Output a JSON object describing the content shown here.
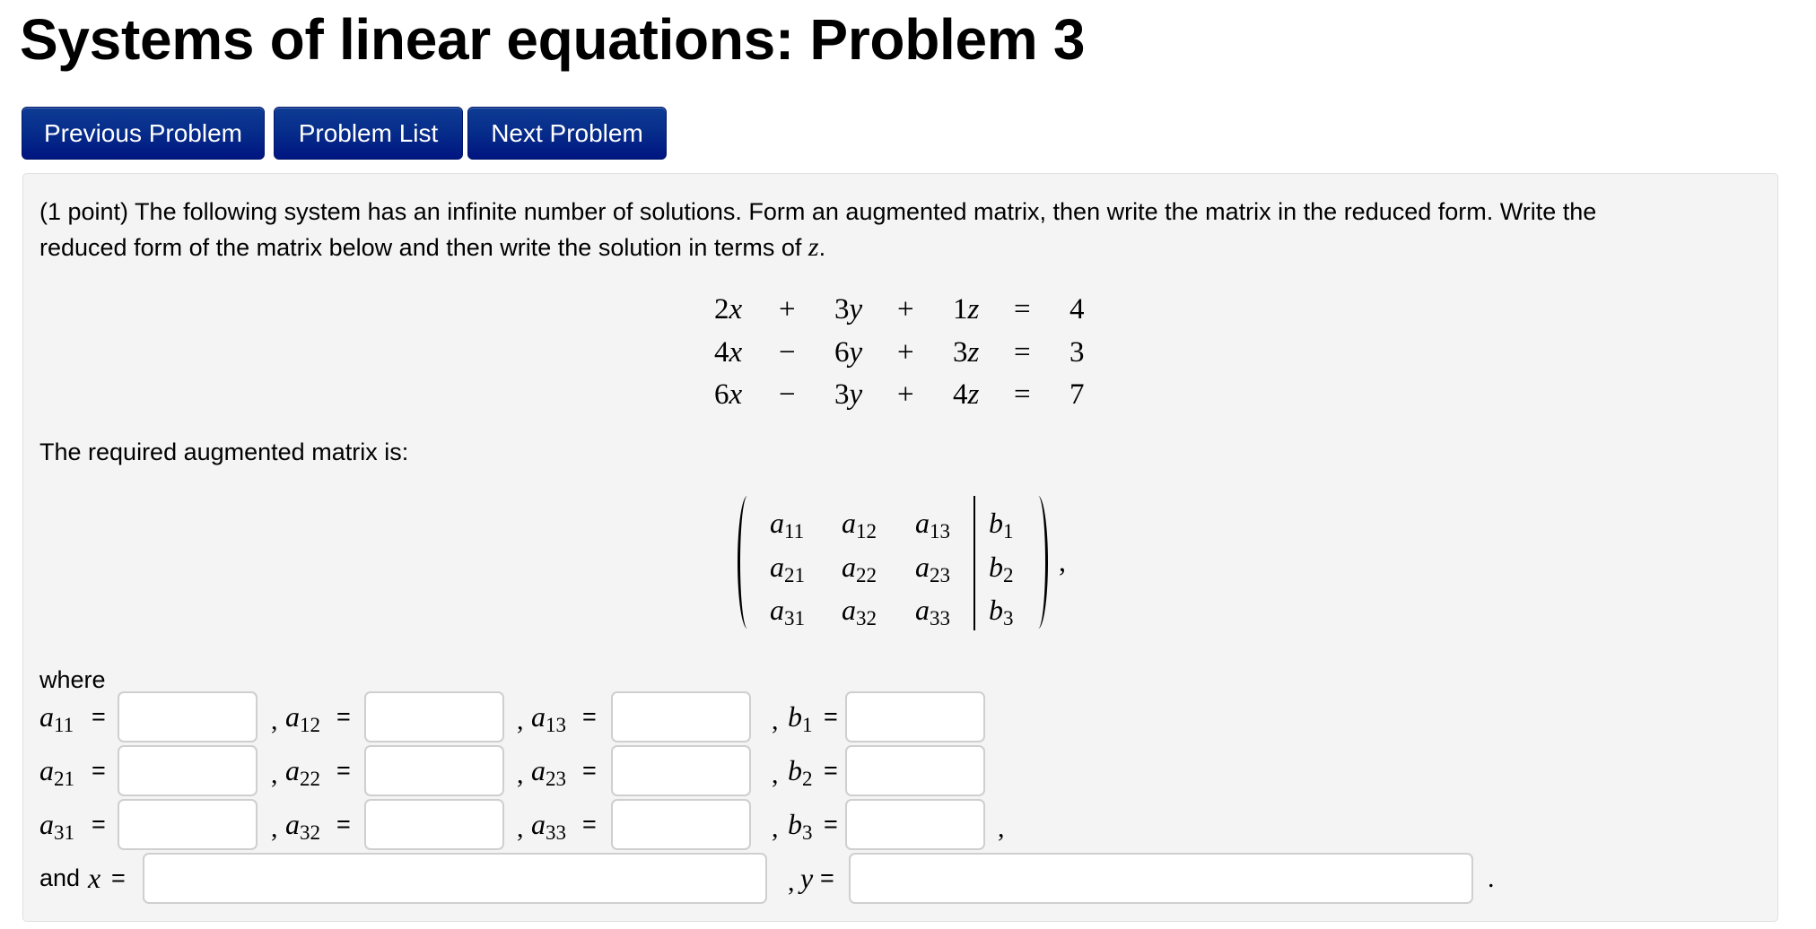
{
  "page": {
    "title": "Systems of linear equations: Problem 3"
  },
  "nav": {
    "previous_label": "Previous Problem",
    "list_label": "Problem List",
    "next_label": "Next Problem",
    "button_color": "#062c8a"
  },
  "problem": {
    "intro_line1": "(1 point) The following system has an infinite number of solutions. Form an augmented matrix, then write the matrix in the reduced form. Write the",
    "intro_line2_prefix": "reduced form of the matrix below and then write the solution in terms of ",
    "intro_line2_var": "z",
    "intro_line2_suffix": ".",
    "system": [
      {
        "x": "2",
        "op1": "+",
        "y": "3",
        "op2": "+",
        "z": "1",
        "eq": "=",
        "rhs": "4"
      },
      {
        "x": "4",
        "op1": "−",
        "y": "6",
        "op2": "+",
        "z": "3",
        "eq": "=",
        "rhs": "3"
      },
      {
        "x": "6",
        "op1": "−",
        "y": "3",
        "op2": "+",
        "z": "4",
        "eq": "=",
        "rhs": "7"
      }
    ],
    "variables": {
      "x": "x",
      "y": "y",
      "z": "z"
    },
    "matrix_intro": "The required augmented matrix is:",
    "matrix": {
      "rows": [
        [
          {
            "v": "a",
            "s": "11"
          },
          {
            "v": "a",
            "s": "12"
          },
          {
            "v": "a",
            "s": "13"
          },
          {
            "v": "b",
            "s": "1"
          }
        ],
        [
          {
            "v": "a",
            "s": "21"
          },
          {
            "v": "a",
            "s": "22"
          },
          {
            "v": "a",
            "s": "23"
          },
          {
            "v": "b",
            "s": "2"
          }
        ],
        [
          {
            "v": "a",
            "s": "31"
          },
          {
            "v": "a",
            "s": "32"
          },
          {
            "v": "a",
            "s": "33"
          },
          {
            "v": "b",
            "s": "3"
          }
        ]
      ],
      "trailing": ","
    },
    "where_label": "where",
    "answer_rows": [
      [
        {
          "v": "a",
          "s": "11",
          "value": ""
        },
        {
          "v": "a",
          "s": "12",
          "value": ""
        },
        {
          "v": "a",
          "s": "13",
          "value": ""
        },
        {
          "v": "b",
          "s": "1",
          "value": ""
        }
      ],
      [
        {
          "v": "a",
          "s": "21",
          "value": ""
        },
        {
          "v": "a",
          "s": "22",
          "value": ""
        },
        {
          "v": "a",
          "s": "23",
          "value": ""
        },
        {
          "v": "b",
          "s": "2",
          "value": ""
        }
      ],
      [
        {
          "v": "a",
          "s": "31",
          "value": ""
        },
        {
          "v": "a",
          "s": "32",
          "value": ""
        },
        {
          "v": "a",
          "s": "33",
          "value": ""
        },
        {
          "v": "b",
          "s": "3",
          "value": ""
        }
      ]
    ],
    "equals": "=",
    "comma": ",",
    "and_label": "and",
    "x_label": "x",
    "y_label": "y",
    "x_value": "",
    "y_value": "",
    "final_period": "."
  }
}
